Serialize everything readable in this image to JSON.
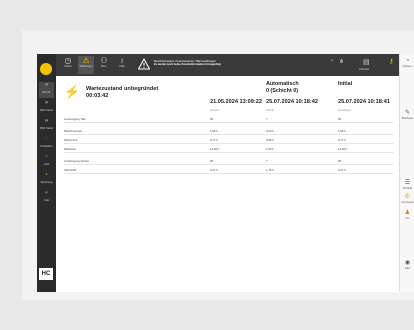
{
  "left_rail": {
    "items": [
      {
        "label": "Betrieb",
        "active": true,
        "icon": "sun-icon"
      },
      {
        "label": "BR1 Stand",
        "icon": "bar-icon"
      },
      {
        "label": "BR2 Stand",
        "icon": "bar-icon"
      },
      {
        "label": "Produktion",
        "icon": "chart-icon"
      },
      {
        "label": "Jobs",
        "icon": "gear-icon"
      },
      {
        "label": "Werkzeug",
        "icon": "tool-icon"
      },
      {
        "label": "CLE",
        "icon": "cle-icon"
      }
    ],
    "brand": "HC"
  },
  "top_bar": {
    "buttons": [
      {
        "label": "Status",
        "icon": "clock-icon"
      },
      {
        "label": "Meldungen",
        "icon": "warning-icon",
        "active": true
      },
      {
        "label": "Bes.",
        "icon": "user-icon"
      },
      {
        "label": "Hilfe",
        "icon": "help-icon"
      }
    ],
    "warning_line1": "Maschinenstatus / Kommentieren / Warnmeldungen",
    "warning_line2": "Es wurde noch keine Zusatzinformation hinzugefügt",
    "right_label": "Kalender",
    "accent": "#f5c400"
  },
  "status": {
    "title": "Wartezustand unbegründet",
    "time": "00:03:42"
  },
  "columns": [
    {
      "header": "",
      "date": "21.05.2024 13:09:22",
      "sub": "Intervall"
    },
    {
      "header": "Automatisch\n0 (Schicht 0)",
      "date": "25.07.2024 10:18:42",
      "sub": "Schicht"
    },
    {
      "header": "Initial",
      "date": "25.07.2024 10:18:41",
      "sub": "Gesamtwert"
    }
  ],
  "rows": [
    {
      "label": "Ausbringung Takt",
      "values": [
        "96",
        "7",
        "96"
      ]
    },
    {
      "label": "Maschinenzeit",
      "values": [
        "1,85 h",
        "0,00 h",
        "1,85 h"
      ],
      "gap": true
    },
    {
      "label": "Wartenzeit",
      "values": [
        "0,77 h",
        "0,05 h",
        "0,77 h"
      ]
    },
    {
      "label": "Wartezeit",
      "values": [
        "14,68 h",
        "1,83 h",
        "14,68 h"
      ]
    },
    {
      "label": "Ausbringung Stücke",
      "values": [
        "96",
        "7",
        "96"
      ],
      "gap": true
    },
    {
      "label": "Stückzahl",
      "values": [
        "0,07 h",
        "1,75 h",
        "0,07 h"
      ]
    }
  ],
  "right_rail": {
    "items": [
      {
        "label": "Optionen",
        "icon": "options-icon"
      },
      {
        "label": "Bearbeiten",
        "icon": "edit-icon"
      },
      {
        "label": "Protokoll",
        "icon": "list-icon"
      },
      {
        "label": "Kommentar",
        "icon": "comment-icon"
      },
      {
        "label": "Info",
        "icon": "person-icon"
      },
      {
        "label": "Filter",
        "icon": "filter-icon"
      }
    ]
  }
}
